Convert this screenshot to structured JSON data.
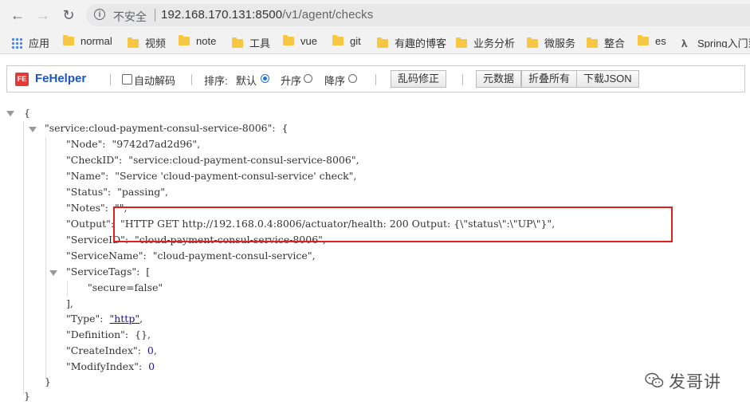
{
  "browser": {
    "insecure_label": "不安全",
    "url_host": "192.168.170.131:8500",
    "url_path": "/v1/agent/checks"
  },
  "bookmarks": [
    {
      "label": "应用",
      "icon": "apps-icon"
    },
    {
      "label": "normal",
      "icon": "folder-icon"
    },
    {
      "label": "视频",
      "icon": "folder-icon"
    },
    {
      "label": "note",
      "icon": "folder-icon"
    },
    {
      "label": "工具",
      "icon": "folder-icon"
    },
    {
      "label": "vue",
      "icon": "folder-icon"
    },
    {
      "label": "git",
      "icon": "folder-icon"
    },
    {
      "label": "有趣的博客",
      "icon": "folder-icon"
    },
    {
      "label": "业务分析",
      "icon": "folder-icon"
    },
    {
      "label": "微服务",
      "icon": "folder-icon"
    },
    {
      "label": "整合",
      "icon": "folder-icon"
    },
    {
      "label": "es",
      "icon": "folder-icon"
    },
    {
      "label": "Spring入门到",
      "icon": "spring-icon"
    }
  ],
  "toolbar": {
    "logo_text": "FE",
    "title": "FeHelper",
    "auto_decode": "自动解码",
    "sort_label": "排序:",
    "sort_default": "默认",
    "sort_asc": "升序",
    "sort_desc": "降序",
    "fix_garbled": "乱码修正",
    "metadata": "元数据",
    "collapse_all": "折叠所有",
    "download_json": "下载JSON"
  },
  "json_lines": {
    "open_root": "{",
    "service_key": "\"service:cloud-payment-consul-service-8006\":",
    "service_open": "{",
    "node": "\"Node\":  \"9742d7ad2d96\",",
    "checkid": "\"CheckID\":  \"service:cloud-payment-consul-service-8006\",",
    "name": "\"Name\":  \"Service 'cloud-payment-consul-service' check\",",
    "status": "\"Status\":  \"passing\",",
    "notes": "\"Notes\":  \"\",",
    "output": "\"Output\":  \"HTTP GET http://192.168.0.4:8006/actuator/health: 200 Output: {\\\"status\\\":\\\"UP\\\"}\",",
    "serviceid": "\"ServiceID\":  \"cloud-payment-consul-service-8006\",",
    "servicename": "\"ServiceName\":  \"cloud-payment-consul-service\",",
    "servicetags_key": "\"ServiceTags\":",
    "servicetags_open": "[",
    "tag0": "\"secure=false\"",
    "servicetags_close": "],",
    "type_key": "\"Type\":  ",
    "type_val": "\"http\"",
    "type_comma": ",",
    "definition": "\"Definition\":  {},",
    "createindex_key": "\"CreateIndex\":  ",
    "createindex_val": "0",
    "createindex_comma": ",",
    "modifyindex_key": "\"ModifyIndex\":  ",
    "modifyindex_val": "0",
    "service_close": "}",
    "close_root": "}"
  },
  "watermark": {
    "text": "发哥讲"
  },
  "colors": {
    "highlight_box": "#e02020",
    "fehelper_blue": "#1a56c8",
    "folder": "#f7c744"
  }
}
